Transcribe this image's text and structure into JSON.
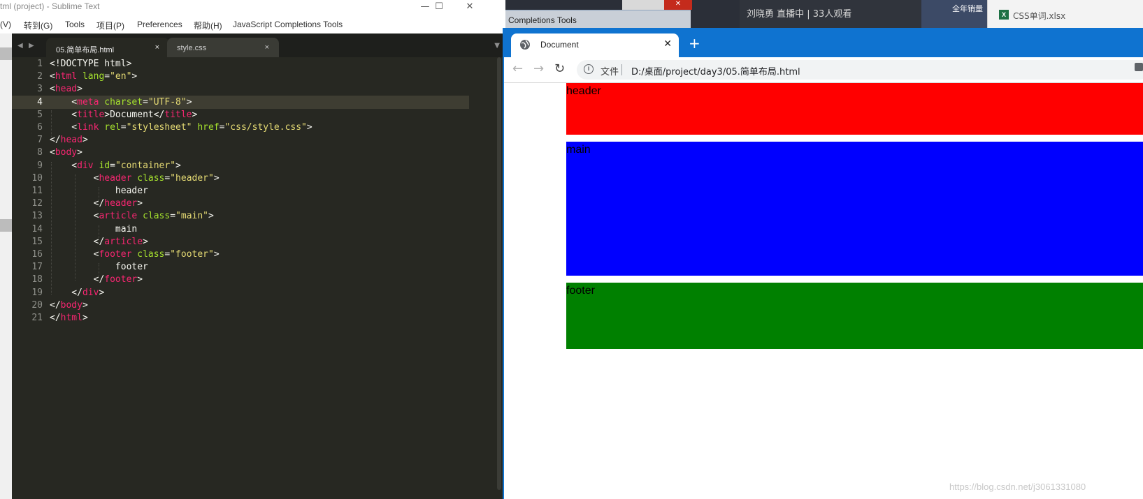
{
  "sublime": {
    "title": "tml (project) - Sublime Text",
    "window_controls": [
      "—",
      "☐",
      "✕"
    ],
    "menu": [
      "(V)",
      "转到(G)",
      "Tools",
      "项目(P)",
      "Preferences",
      "帮助(H)",
      "JavaScript Completions Tools"
    ],
    "tabs": [
      {
        "label": "05.简单布局.html",
        "active": true,
        "close": "×"
      },
      {
        "label": "style.css",
        "active": false,
        "close": "×"
      }
    ],
    "tab_nav": {
      "prev": "◀",
      "next": "▶",
      "overflow": "▼"
    },
    "current_line": 4,
    "line_numbers": [
      "1",
      "2",
      "3",
      "4",
      "5",
      "6",
      "7",
      "8",
      "9",
      "10",
      "11",
      "12",
      "13",
      "14",
      "15",
      "16",
      "17",
      "18",
      "19",
      "20",
      "21"
    ],
    "code": [
      [
        {
          "c": "txt",
          "t": "<!DOCTYPE html>"
        }
      ],
      [
        {
          "c": "txt",
          "t": "<"
        },
        {
          "c": "tag",
          "t": "html"
        },
        {
          "c": "attr",
          "t": " lang"
        },
        {
          "c": "txt",
          "t": "="
        },
        {
          "c": "str",
          "t": "\"en\""
        },
        {
          "c": "txt",
          "t": ">"
        }
      ],
      [
        {
          "c": "txt",
          "t": "<"
        },
        {
          "c": "tag",
          "t": "head"
        },
        {
          "c": "txt",
          "t": ">"
        }
      ],
      [
        {
          "c": "txt",
          "t": "    <"
        },
        {
          "c": "tag",
          "t": "meta"
        },
        {
          "c": "attr",
          "t": " charset"
        },
        {
          "c": "txt",
          "t": "="
        },
        {
          "c": "str",
          "t": "\"UTF-8\""
        },
        {
          "c": "txt",
          "t": ">"
        }
      ],
      [
        {
          "c": "txt",
          "t": "    <"
        },
        {
          "c": "tag",
          "t": "title"
        },
        {
          "c": "txt",
          "t": ">Document</"
        },
        {
          "c": "tag",
          "t": "title"
        },
        {
          "c": "txt",
          "t": ">"
        }
      ],
      [
        {
          "c": "txt",
          "t": "    <"
        },
        {
          "c": "tag",
          "t": "link"
        },
        {
          "c": "attr",
          "t": " rel"
        },
        {
          "c": "txt",
          "t": "="
        },
        {
          "c": "str",
          "t": "\"stylesheet\""
        },
        {
          "c": "attr",
          "t": " href"
        },
        {
          "c": "txt",
          "t": "="
        },
        {
          "c": "str",
          "t": "\"css/style.css\""
        },
        {
          "c": "txt",
          "t": ">"
        }
      ],
      [
        {
          "c": "txt",
          "t": "</"
        },
        {
          "c": "tag",
          "t": "head"
        },
        {
          "c": "txt",
          "t": ">"
        }
      ],
      [
        {
          "c": "txt",
          "t": "<"
        },
        {
          "c": "tag",
          "t": "body"
        },
        {
          "c": "txt",
          "t": ">"
        }
      ],
      [
        {
          "c": "txt",
          "t": "    <"
        },
        {
          "c": "tag",
          "t": "div"
        },
        {
          "c": "attr",
          "t": " id"
        },
        {
          "c": "txt",
          "t": "="
        },
        {
          "c": "str",
          "t": "\"container\""
        },
        {
          "c": "txt",
          "t": ">"
        }
      ],
      [
        {
          "c": "txt",
          "t": "        <"
        },
        {
          "c": "tag",
          "t": "header"
        },
        {
          "c": "attr",
          "t": " class"
        },
        {
          "c": "txt",
          "t": "="
        },
        {
          "c": "str",
          "t": "\"header\""
        },
        {
          "c": "txt",
          "t": ">"
        }
      ],
      [
        {
          "c": "txt",
          "t": "            header"
        }
      ],
      [
        {
          "c": "txt",
          "t": "        </"
        },
        {
          "c": "tag",
          "t": "header"
        },
        {
          "c": "txt",
          "t": ">"
        }
      ],
      [
        {
          "c": "txt",
          "t": "        <"
        },
        {
          "c": "tag",
          "t": "article"
        },
        {
          "c": "attr",
          "t": " class"
        },
        {
          "c": "txt",
          "t": "="
        },
        {
          "c": "str",
          "t": "\"main\""
        },
        {
          "c": "txt",
          "t": ">"
        }
      ],
      [
        {
          "c": "txt",
          "t": "            main"
        }
      ],
      [
        {
          "c": "txt",
          "t": "        </"
        },
        {
          "c": "tag",
          "t": "article"
        },
        {
          "c": "txt",
          "t": ">"
        }
      ],
      [
        {
          "c": "txt",
          "t": "        <"
        },
        {
          "c": "tag",
          "t": "footer"
        },
        {
          "c": "attr",
          "t": " class"
        },
        {
          "c": "txt",
          "t": "="
        },
        {
          "c": "str",
          "t": "\"footer\""
        },
        {
          "c": "txt",
          "t": ">"
        }
      ],
      [
        {
          "c": "txt",
          "t": "            footer"
        }
      ],
      [
        {
          "c": "txt",
          "t": "        </"
        },
        {
          "c": "tag",
          "t": "footer"
        },
        {
          "c": "txt",
          "t": ">"
        }
      ],
      [
        {
          "c": "txt",
          "t": "    </"
        },
        {
          "c": "tag",
          "t": "div"
        },
        {
          "c": "txt",
          "t": ">"
        }
      ],
      [
        {
          "c": "txt",
          "t": "</"
        },
        {
          "c": "tag",
          "t": "body"
        },
        {
          "c": "txt",
          "t": ">"
        }
      ],
      [
        {
          "c": "txt",
          "t": "</"
        },
        {
          "c": "tag",
          "t": "html"
        },
        {
          "c": "txt",
          "t": ">"
        }
      ]
    ],
    "syntax_colors": {
      "tag": "#f92672",
      "attr": "#a6e22e",
      "str": "#e6db74",
      "txt": "#f8f8f2"
    }
  },
  "background": {
    "completions_window_label": "Completions Tools",
    "close_glyph": "✕",
    "live_text": "刘晓勇 直播中 | 33人观看",
    "thumb_text": "全年销量",
    "excel_icon_letter": "X",
    "excel_file": "CSS单词.xlsx"
  },
  "chrome": {
    "tab_title": "Document",
    "tab_close": "✕",
    "new_tab": "+",
    "nav": {
      "back": "←",
      "forward": "→",
      "reload": "↻"
    },
    "info_icon": "i",
    "file_label": "文件",
    "url": "D:/桌面/project/day3/05.简单布局.html",
    "accent_color": "#0f73d0"
  },
  "page": {
    "header_text": "header",
    "main_text": "main",
    "footer_text": "footer",
    "colors": {
      "header": "#ff0000",
      "main": "#0000ff",
      "footer": "#008000"
    }
  },
  "watermark": "https://blog.csdn.net/j3061331080"
}
